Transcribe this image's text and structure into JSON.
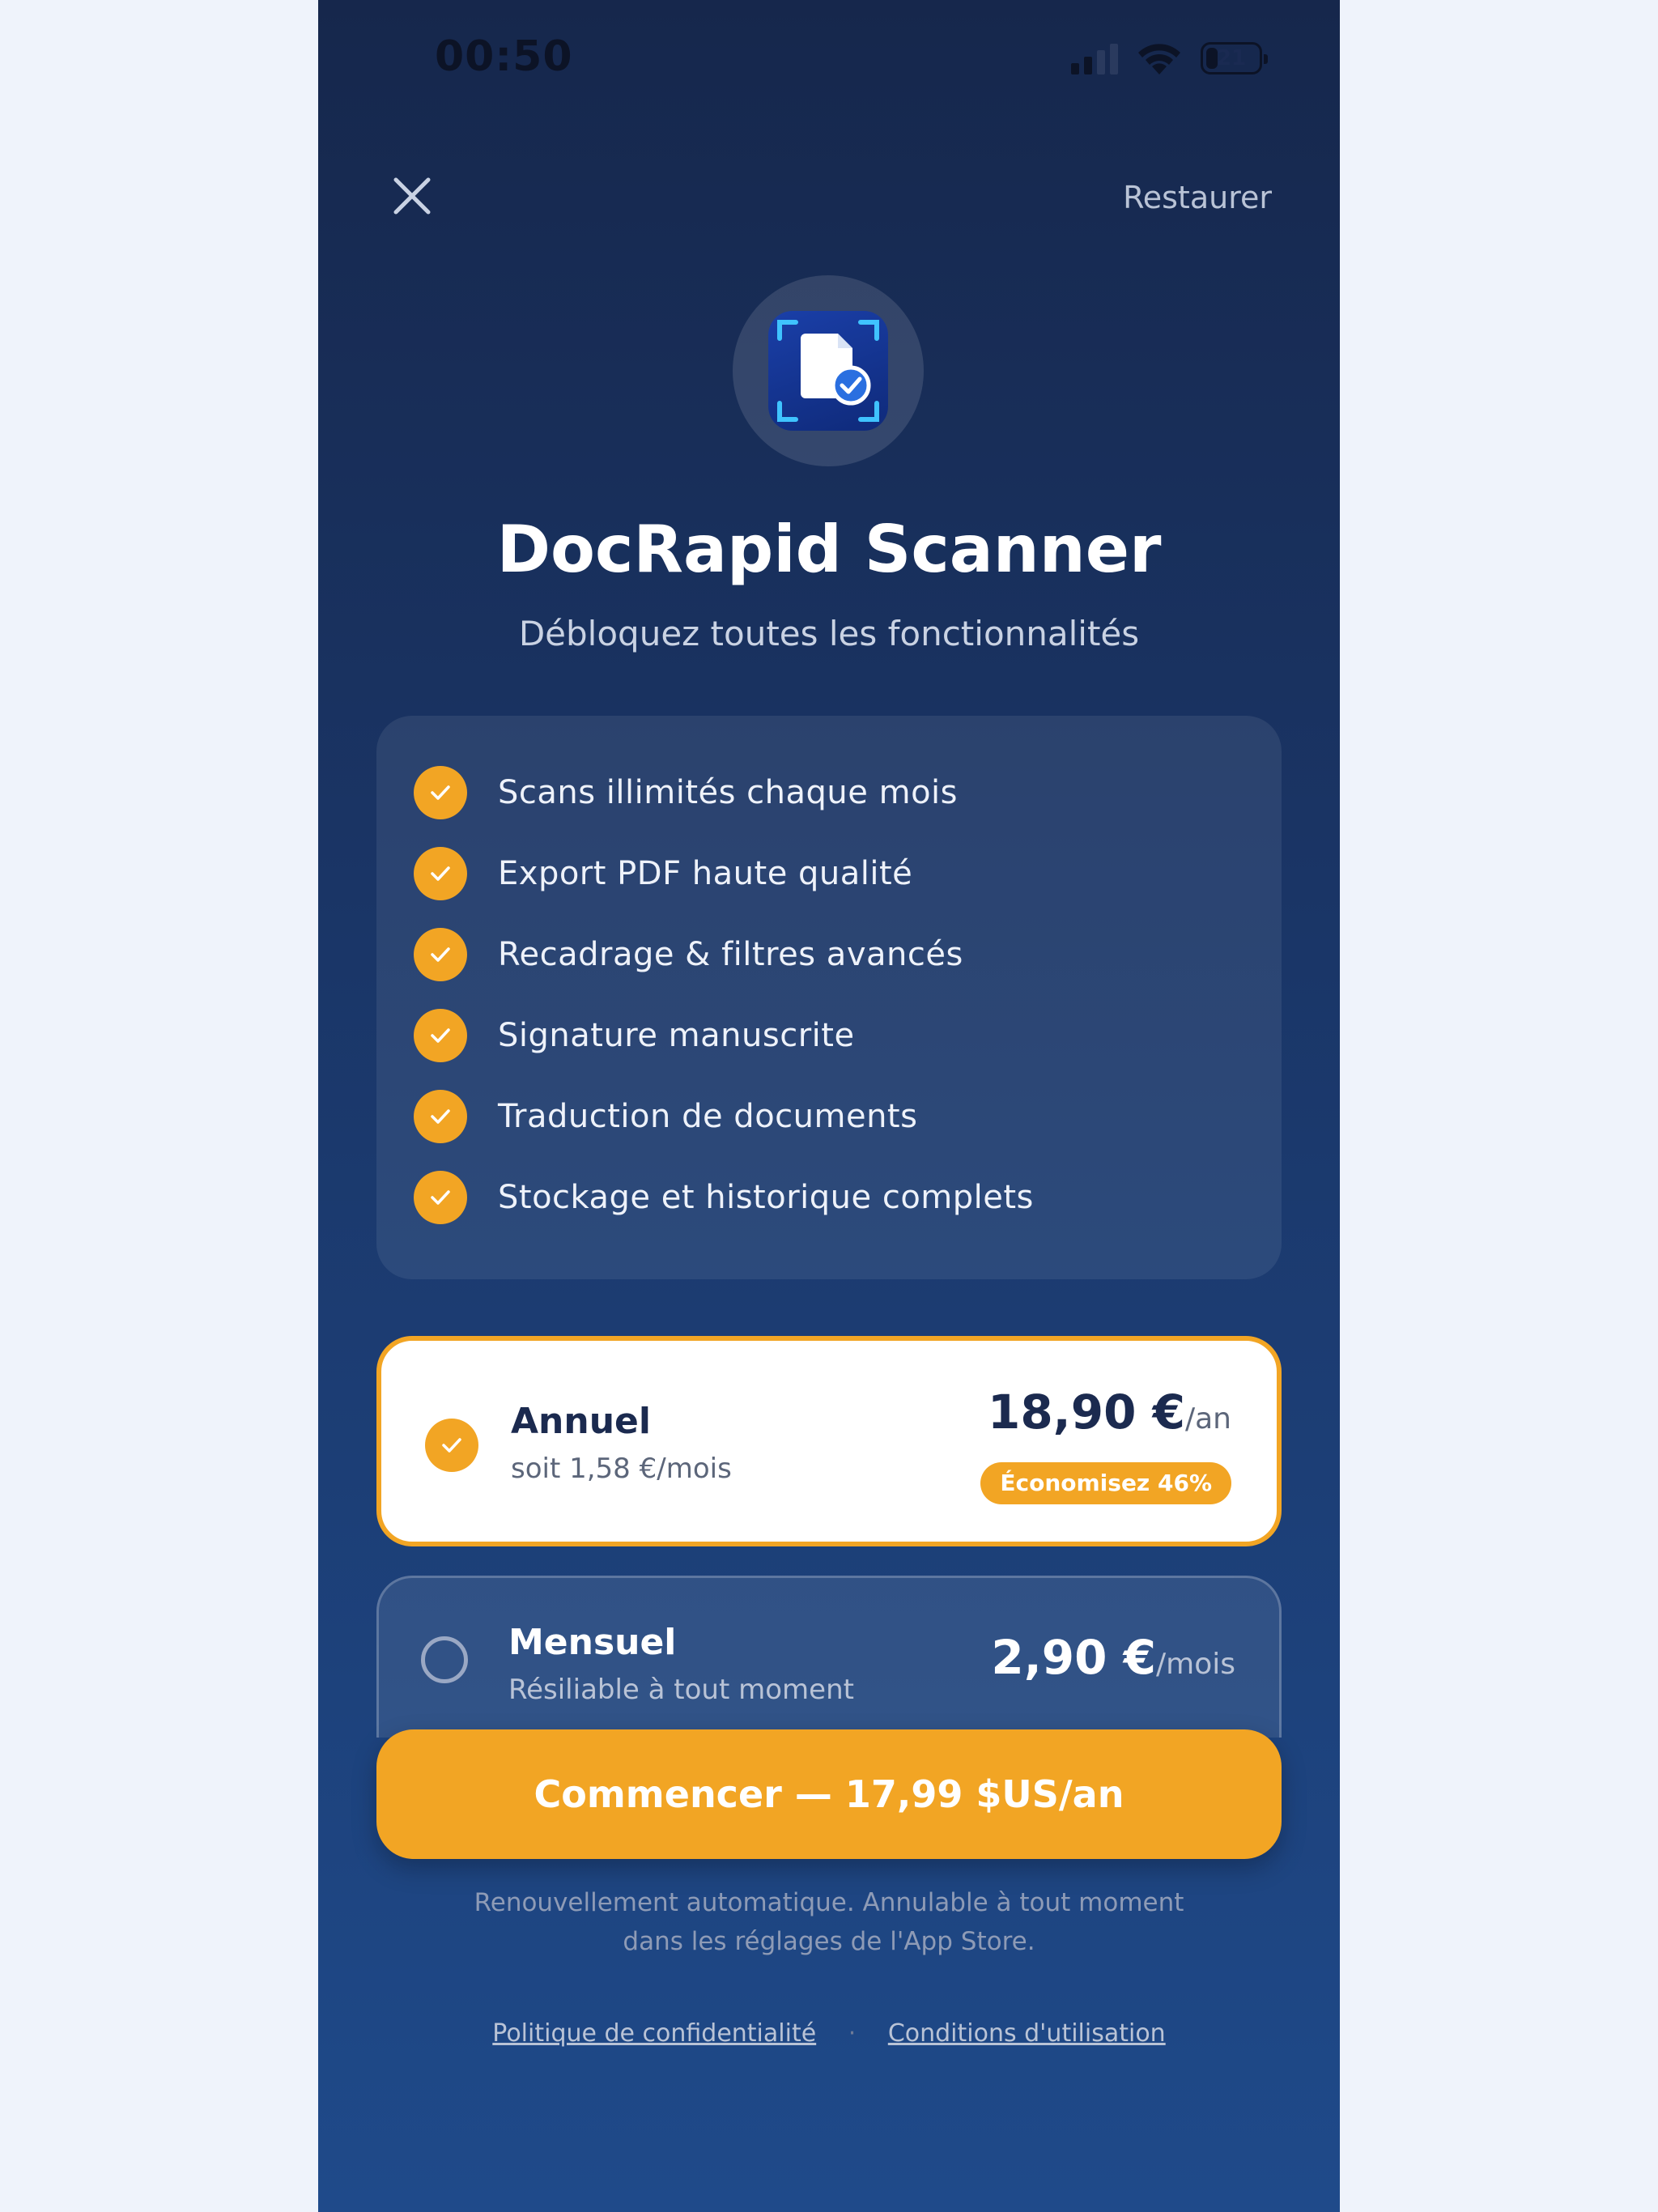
{
  "status_bar": {
    "time": "00:50",
    "battery": "21"
  },
  "header": {
    "close_icon": "close-icon",
    "restore_label": "Restaurer"
  },
  "app": {
    "icon": "document-scan-check-icon",
    "title": "DocRapid Scanner",
    "subtitle": "Débloquez toutes les fonctionnalités"
  },
  "features": [
    {
      "label": "Scans illimités chaque mois"
    },
    {
      "label": "Export PDF haute qualité"
    },
    {
      "label": "Recadrage & filtres avancés"
    },
    {
      "label": "Signature manuscrite"
    },
    {
      "label": "Traduction de documents"
    },
    {
      "label": "Stockage et historique complets"
    }
  ],
  "plans": {
    "annual": {
      "name": "Annuel",
      "detail": "soit 1,58 €/mois",
      "price": "18,90 €",
      "unit": "/an",
      "badge": "Économisez 46%",
      "selected": true
    },
    "monthly": {
      "name": "Mensuel",
      "detail": "Résiliable à tout moment",
      "price": "2,90 €",
      "unit": "/mois",
      "selected": false
    }
  },
  "cta": {
    "label": "Commencer — 17,99 $US/an"
  },
  "legal": {
    "line1": "Renouvellement automatique. Annulable à tout moment",
    "line2": "dans les réglages de l'App Store."
  },
  "footer": {
    "privacy": "Politique de confidentialité",
    "separator": "·",
    "terms": "Conditions d'utilisation"
  },
  "colors": {
    "accent": "#f2a524",
    "background_top": "#16274c",
    "background_bottom": "#1f4a8a"
  }
}
